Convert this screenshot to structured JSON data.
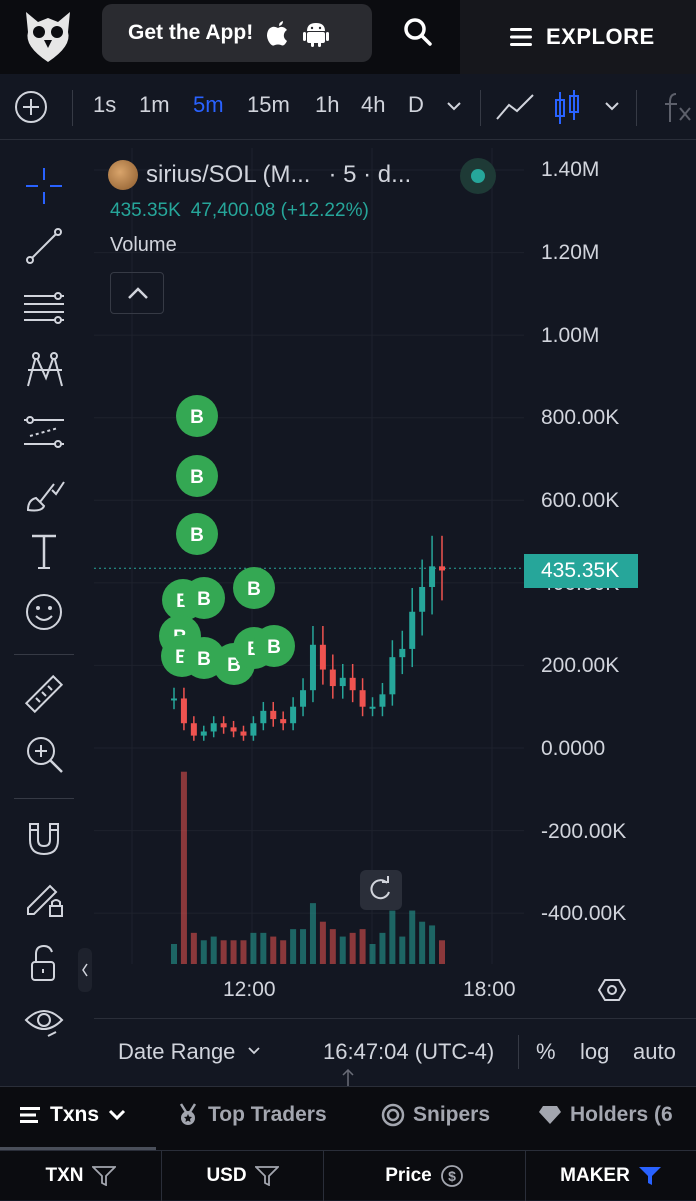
{
  "header": {
    "get_app_label": "Get the App!",
    "explore_label": "EXPLORE"
  },
  "toolbar": {
    "intervals": [
      "1s",
      "1m",
      "5m",
      "15m",
      "1h",
      "4h",
      "D"
    ],
    "active_interval": "5m"
  },
  "symbol": {
    "title": "sirius/SOL (M...",
    "subtitle": "· 5 · d...",
    "price": "435.35K",
    "change": "47,400.08 (+12.22%)",
    "volume_label": "Volume"
  },
  "colors": {
    "up": "#26a69a",
    "down": "#ef5350",
    "accent": "#2962ff",
    "marker": "#34a853"
  },
  "chart_data": {
    "type": "candlestick",
    "ylim": [
      -480000,
      1450000
    ],
    "y_ticks": [
      "1.40M",
      "1.20M",
      "1.00M",
      "800.00K",
      "600.00K",
      "400.00K",
      "200.00K",
      "0.0000",
      "-200.00K",
      "-400.00K"
    ],
    "last_price_label": "435.35K",
    "last_price": 435350,
    "x_ticks": [
      "12:00",
      "18:00"
    ],
    "markers": [
      "B",
      "B",
      "B",
      "B",
      "B",
      "B",
      "B",
      "B",
      "B",
      "B",
      "B",
      "B"
    ],
    "price_series": [
      120000,
      60000,
      30000,
      40000,
      60000,
      50000,
      40000,
      30000,
      60000,
      90000,
      70000,
      60000,
      100000,
      140000,
      250000,
      190000,
      150000,
      170000,
      140000,
      100000,
      100000,
      130000,
      220000,
      240000,
      330000,
      390000,
      440000,
      430000
    ]
  },
  "price_scale": {
    "ticks": [
      "1.40M",
      "1.20M",
      "1.00M",
      "800.00K",
      "600.00K",
      "400.00K",
      "200.00K",
      "0.0000",
      "-200.00K",
      "-400.00K"
    ]
  },
  "time_axis": {
    "labels": [
      "12:00",
      "18:00"
    ]
  },
  "bottombar": {
    "date_range": "Date Range",
    "time": "16:47:04 (UTC-4)",
    "percent": "%",
    "log": "log",
    "auto": "auto"
  },
  "tabs": [
    {
      "label": "Txns"
    },
    {
      "label": "Top Traders"
    },
    {
      "label": "Snipers"
    },
    {
      "label": "Holders (6"
    }
  ],
  "table_header": [
    "TXN",
    "USD",
    "Price",
    "MAKER"
  ]
}
